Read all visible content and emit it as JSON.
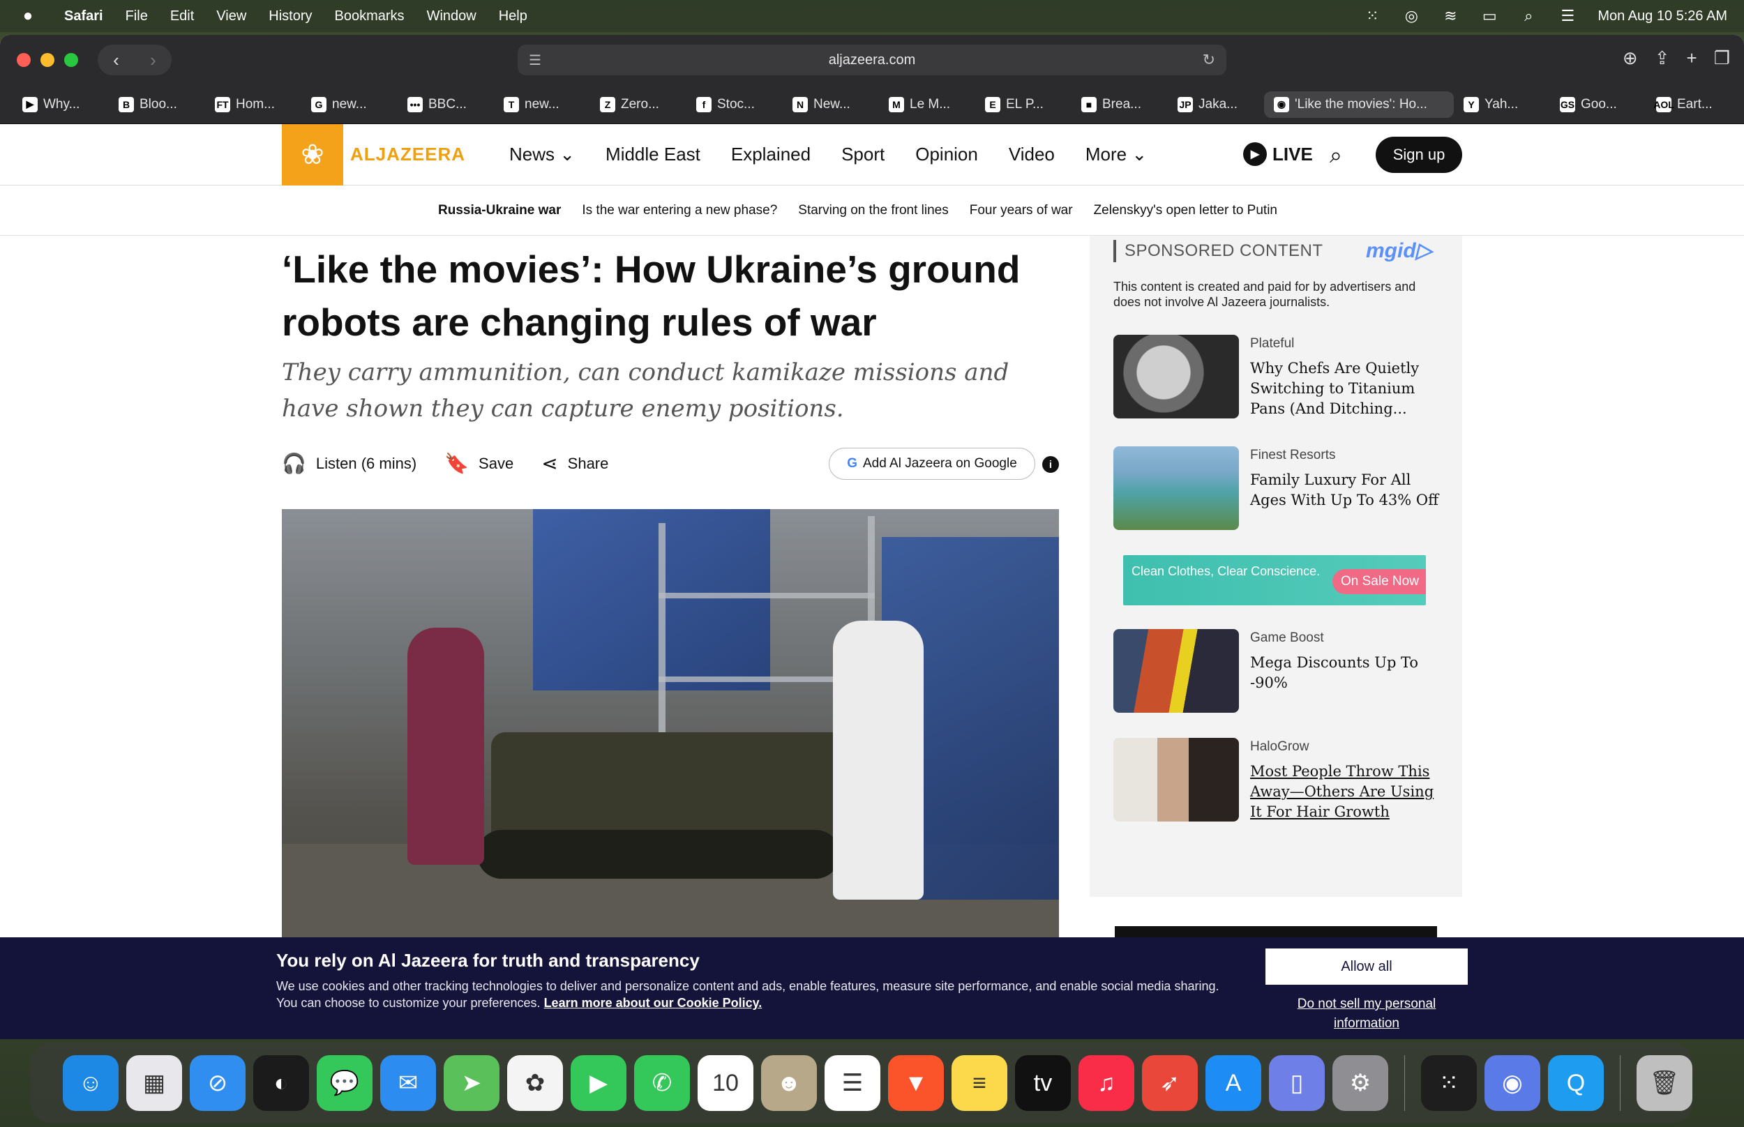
{
  "menubar": {
    "apple": "",
    "items": [
      "Safari",
      "File",
      "Edit",
      "View",
      "History",
      "Bookmarks",
      "Window",
      "Help"
    ],
    "clock": "Mon Aug 10  5:26 AM"
  },
  "browser": {
    "url": "aljazeera.com",
    "tabs": [
      {
        "icon": "▶",
        "label": "Why..."
      },
      {
        "icon": "B",
        "label": "Bloo..."
      },
      {
        "icon": "FT",
        "label": "Hom..."
      },
      {
        "icon": "G",
        "label": "new..."
      },
      {
        "icon": "•••",
        "label": "BBC..."
      },
      {
        "icon": "T",
        "label": "new..."
      },
      {
        "icon": "Z",
        "label": "Zero..."
      },
      {
        "icon": "f",
        "label": "Stoc..."
      },
      {
        "icon": "N",
        "label": "New..."
      },
      {
        "icon": "M",
        "label": "Le M..."
      },
      {
        "icon": "E",
        "label": "EL P..."
      },
      {
        "icon": "■",
        "label": "Brea..."
      },
      {
        "icon": "JP",
        "label": "Jaka..."
      },
      {
        "icon": "◉",
        "label": "'Like the movies': Ho..."
      },
      {
        "icon": "Y",
        "label": "Yah..."
      },
      {
        "icon": "GS",
        "label": "Goo..."
      },
      {
        "icon": "AOL",
        "label": "Eart..."
      }
    ]
  },
  "site": {
    "logo_text": "ALJAZEERA",
    "nav": [
      "News ⌄",
      "Middle East",
      "Explained",
      "Sport",
      "Opinion",
      "Video",
      "More ⌄"
    ],
    "live": "LIVE",
    "signup": "Sign up",
    "subnav": [
      "Russia-Ukraine war",
      "Is the war entering a new phase?",
      "Starving on the front lines",
      "Four years of war",
      "Zelenskyy's open letter to Putin"
    ]
  },
  "article": {
    "headline": "‘Like the movies’: How Ukraine’s ground robots are changing rules of war",
    "dek": "They carry ammunition, can conduct kamikaze missions and have shown they can capture enemy positions.",
    "listen": "Listen (6 mins)",
    "save": "Save",
    "share": "Share",
    "google_btn": "Add Al Jazeera on Google"
  },
  "sidebar": {
    "sponsored": "SPONSORED CONTENT",
    "mgid": "mgid",
    "disclaimer": "This content is created and paid for by advertisers and does not involve Al Jazeera journalists.",
    "cards": [
      {
        "source": "Plateful",
        "title": "Why Chefs Are Quietly Switching to Titanium Pans (And Ditching..."
      },
      {
        "source": "Finest Resorts",
        "title": "Family Luxury For All Ages With Up To 43% Off"
      },
      {
        "source": "Game Boost",
        "title": "Mega Discounts Up To -90%"
      },
      {
        "source": "HaloGrow",
        "title": "Most People Throw This Away—Others Are Using It For Hair Growth"
      }
    ],
    "banner_text": "Clean Clothes, Clear Conscience.",
    "banner_cta": "On Sale Now"
  },
  "cookie": {
    "title": "You rely on Al Jazeera for truth and transparency",
    "body": "We use cookies and other tracking technologies to deliver and personalize content and ads, enable features, measure site performance, and enable social media sharing. You can choose to customize your preferences. ",
    "link": "Learn more about our Cookie Policy.",
    "allow": "Allow all",
    "do_not_sell": "Do not sell my personal information"
  },
  "dock": {
    "apps": [
      {
        "name": "finder",
        "glyph": "☺",
        "color": "#1e88e5"
      },
      {
        "name": "launchpad",
        "glyph": "▦",
        "color": "#e8e8ec"
      },
      {
        "name": "safari",
        "glyph": "⊘",
        "color": "#2f8ef0"
      },
      {
        "name": "podcast",
        "glyph": "◐",
        "color": "#1b1b1b"
      },
      {
        "name": "messages",
        "glyph": "💬",
        "color": "#34c759"
      },
      {
        "name": "mail",
        "glyph": "✉",
        "color": "#2d8cf0"
      },
      {
        "name": "maps",
        "glyph": "➤",
        "color": "#5ac05a"
      },
      {
        "name": "photos",
        "glyph": "✿",
        "color": "#f4f4f4"
      },
      {
        "name": "facetime",
        "glyph": "▶",
        "color": "#34c759"
      },
      {
        "name": "phone",
        "glyph": "✆",
        "color": "#34c759"
      },
      {
        "name": "calendar",
        "glyph": "10",
        "color": "#ffffff"
      },
      {
        "name": "contacts",
        "glyph": "☻",
        "color": "#b8a88a"
      },
      {
        "name": "reminders",
        "glyph": "☰",
        "color": "#ffffff"
      },
      {
        "name": "brave",
        "glyph": "▼",
        "color": "#fb542b"
      },
      {
        "name": "notes",
        "glyph": "≡",
        "color": "#fcd94a"
      },
      {
        "name": "tv",
        "glyph": "tv",
        "color": "#111111"
      },
      {
        "name": "music",
        "glyph": "♫",
        "color": "#fa2d48"
      },
      {
        "name": "rocket",
        "glyph": "➶",
        "color": "#e9473a"
      },
      {
        "name": "app-store",
        "glyph": "A",
        "color": "#1e8cf5"
      },
      {
        "name": "simulator",
        "glyph": "▯",
        "color": "#6f7fe8"
      },
      {
        "name": "settings",
        "glyph": "⚙",
        "color": "#8e8e93"
      },
      {
        "name": "grid-app",
        "glyph": "⁙",
        "color": "#1e1e1e"
      },
      {
        "name": "robot-app",
        "glyph": "◉",
        "color": "#5a7ae8"
      },
      {
        "name": "q-app",
        "glyph": "Q",
        "color": "#1e9cf0"
      },
      {
        "name": "trash",
        "glyph": "🗑",
        "color": "#bfbfbf"
      }
    ]
  }
}
